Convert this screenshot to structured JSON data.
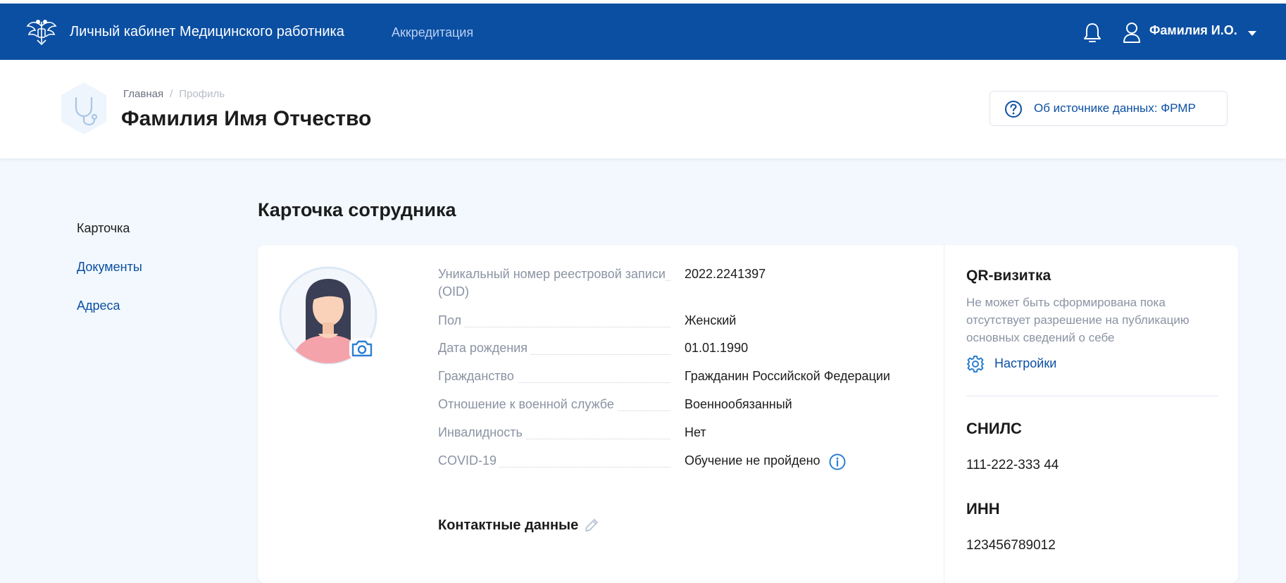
{
  "topbar": {
    "app_title": "Личный кабинет Медицинского работника",
    "nav_link": "Аккредитация",
    "user_name": "Фамилия И.О."
  },
  "header": {
    "breadcrumb": {
      "home": "Главная",
      "separator": "/",
      "current": "Профиль"
    },
    "title": "Фамилия Имя Отчество",
    "source_button": "Об источнике данных: ФРМР"
  },
  "sidebar": {
    "items": [
      {
        "label": "Карточка",
        "active": true
      },
      {
        "label": "Документы",
        "active": false
      },
      {
        "label": "Адреса",
        "active": false
      }
    ]
  },
  "section_title": "Карточка сотрудника",
  "employee": {
    "fields": [
      {
        "label": "Уникальный номер реестровой записи (OID)",
        "value": "2022.2241397"
      },
      {
        "label": "Пол",
        "value": "Женский"
      },
      {
        "label": "Дата рождения",
        "value": "01.01.1990"
      },
      {
        "label": "Гражданство",
        "value": "Гражданин Российской Федерации"
      },
      {
        "label": "Отношение к военной службе",
        "value": "Военнообязанный"
      },
      {
        "label": "Инвалидность",
        "value": "Нет"
      },
      {
        "label": "COVID-19",
        "value": "Обучение не пройдено"
      }
    ],
    "contacts_title": "Контактные данные"
  },
  "qr_card": {
    "title": "QR-визитка",
    "description": "Не может быть сформирована пока отсутствует разрешение на публикацию основных сведений о себе",
    "settings_link": "Настройки"
  },
  "snils": {
    "title": "СНИЛС",
    "value": "111-222-333 44"
  },
  "inn": {
    "title": "ИНН",
    "value": "123456789012"
  },
  "colors": {
    "brand": "#0b4fa3",
    "background": "#f2f8fd",
    "muted": "#8a93a3",
    "accent": "#2c7fd3"
  },
  "icons": [
    "emblem-logo",
    "bell-icon",
    "user-icon",
    "caret-down-icon",
    "stethoscope-icon",
    "question-circle-icon",
    "camera-icon",
    "info-icon",
    "pencil-icon",
    "gear-icon"
  ]
}
